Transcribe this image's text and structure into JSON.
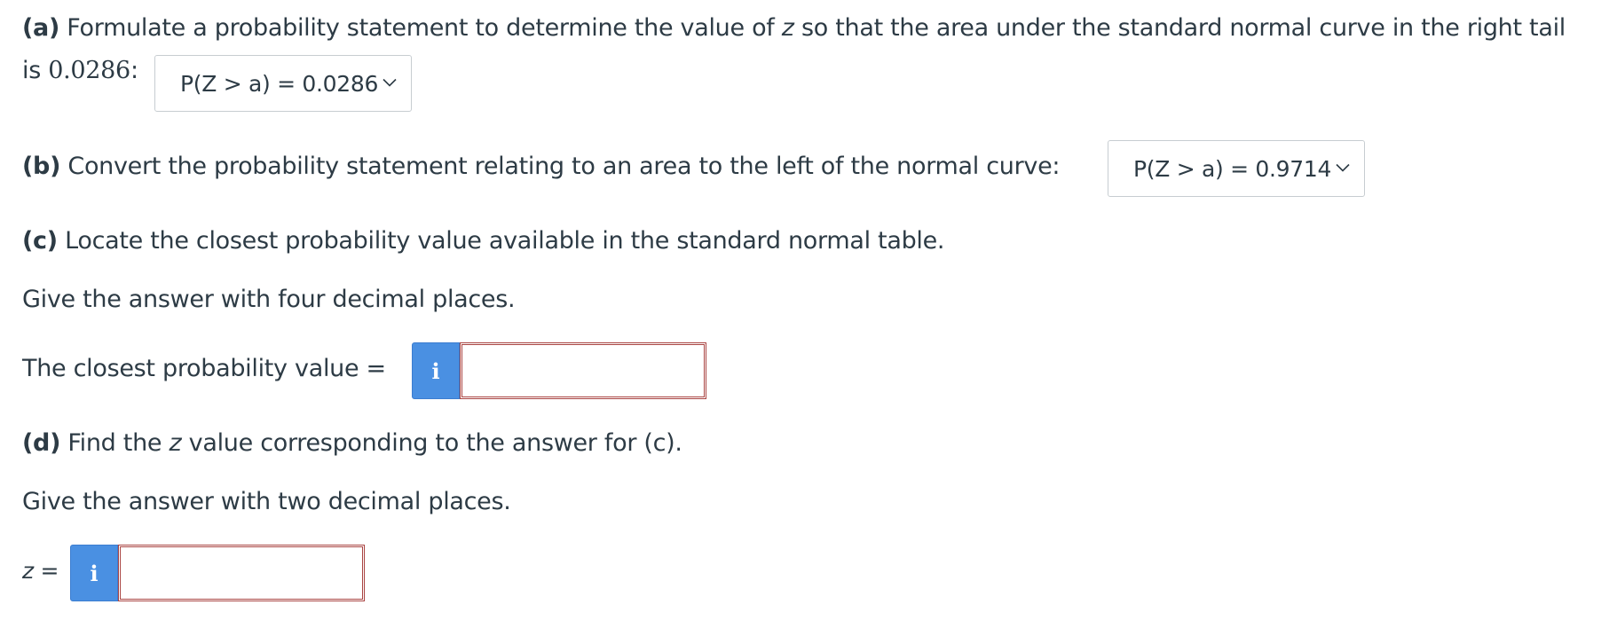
{
  "part_a": {
    "label": "(a)",
    "text_1": " Formulate a probability statement to determine the value of ",
    "var": "z",
    "text_2": " so that the area under the standard normal curve in the right tail",
    "line2_prefix": "is ",
    "area": "0.0286",
    "line2_suffix": ":",
    "select_value": "P(Z > a) = 0.0286"
  },
  "part_b": {
    "label": "(b)",
    "text": " Convert the probability statement relating to an area to the left of the normal curve:",
    "select_value": "P(Z > a) = 0.9714"
  },
  "part_c": {
    "label": "(c)",
    "text": " Locate the closest probability value available in the standard normal table.",
    "instruction": "Give the answer with four decimal places.",
    "input_label": "The closest probability value =",
    "info_icon": "i",
    "input_value": ""
  },
  "part_d": {
    "label": "(d)",
    "text_1": " Find the ",
    "var": "z",
    "text_2": " value corresponding to the answer for (c).",
    "instruction": "Give the answer with two decimal places.",
    "input_label_var": "z",
    "input_label_eq": " =",
    "info_icon": "i",
    "input_value": ""
  },
  "colors": {
    "text": "#2d3b45",
    "info_button": "#4a90e2",
    "input_border": "#a94442",
    "select_border": "#c7cdd1"
  }
}
